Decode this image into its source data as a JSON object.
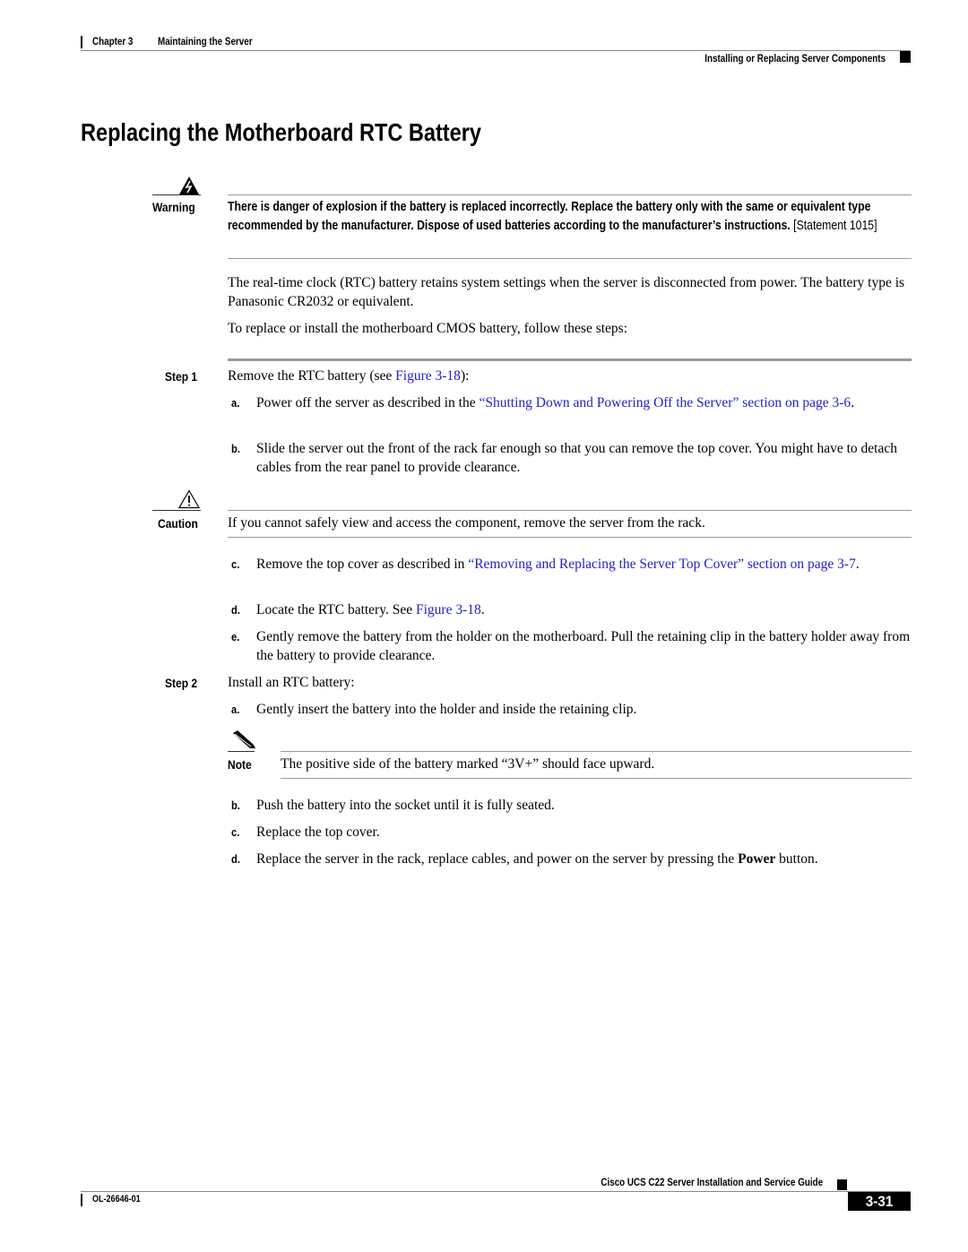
{
  "header": {
    "chapter": "Chapter 3",
    "chapter_title": "Maintaining the Server",
    "section": "Installing or Replacing Server Components"
  },
  "page_title": "Replacing the Motherboard RTC Battery",
  "warning": {
    "label": "Warning",
    "icon": "warning-lightning-icon",
    "text": "There is danger of explosion if the battery is replaced incorrectly. Replace the battery only with the same or equivalent type recommended by the manufacturer. Dispose of used batteries according to the manufacturer’s instructions.",
    "statement": "[Statement 1015]"
  },
  "intro": {
    "p1": "The real-time clock (RTC) battery retains system settings when the server is disconnected from power. The battery type is Panasonic CR2032 or equivalent.",
    "p2": "To replace or install the motherboard CMOS battery, follow these steps:"
  },
  "step1": {
    "label": "Step 1",
    "text_before": "Remove the RTC battery (see ",
    "link": "Figure 3-18",
    "text_after": "):",
    "a": {
      "letter": "a.",
      "text_before": "Power off the server as described in the ",
      "link": "“Shutting Down and Powering Off the Server” section on page 3-6",
      "text_after": "."
    },
    "b": {
      "letter": "b.",
      "text": "Slide the server out the front of the rack far enough so that you can remove the top cover. You might have to detach cables from the rear panel to provide clearance."
    },
    "caution": {
      "label": "Caution",
      "icon": "caution-triangle-icon",
      "text": "If you cannot safely view and access the component, remove the server from the rack."
    },
    "c": {
      "letter": "c.",
      "text_before": "Remove the top cover as described in ",
      "link": "“Removing and Replacing the Server Top Cover” section on page 3-7",
      "text_after": "."
    },
    "d": {
      "letter": "d.",
      "text_before": "Locate the RTC battery. See ",
      "link": "Figure 3-18",
      "text_after": "."
    },
    "e": {
      "letter": "e.",
      "text": "Gently remove the battery from the holder on the motherboard. Pull the retaining clip in the battery holder away from the battery to provide clearance."
    }
  },
  "step2": {
    "label": "Step 2",
    "text": "Install an RTC battery:",
    "a": {
      "letter": "a.",
      "text": "Gently insert the battery into the holder and inside the retaining clip."
    },
    "note": {
      "label": "Note",
      "icon": "note-pencil-icon",
      "text": "The positive side of the battery marked “3V+” should face upward."
    },
    "b": {
      "letter": "b.",
      "text": "Push the battery into the socket until it is fully seated."
    },
    "c": {
      "letter": "c.",
      "text": "Replace the top cover."
    },
    "d": {
      "letter": "d.",
      "text_before": "Replace the server in the rack, replace cables, and power on the server by pressing the ",
      "bold": "Power",
      "text_after": " button."
    }
  },
  "footer": {
    "guide_title": "Cisco UCS C22 Server Installation and Service Guide",
    "doc_number": "OL-26646-01",
    "page_number": "3-31"
  }
}
